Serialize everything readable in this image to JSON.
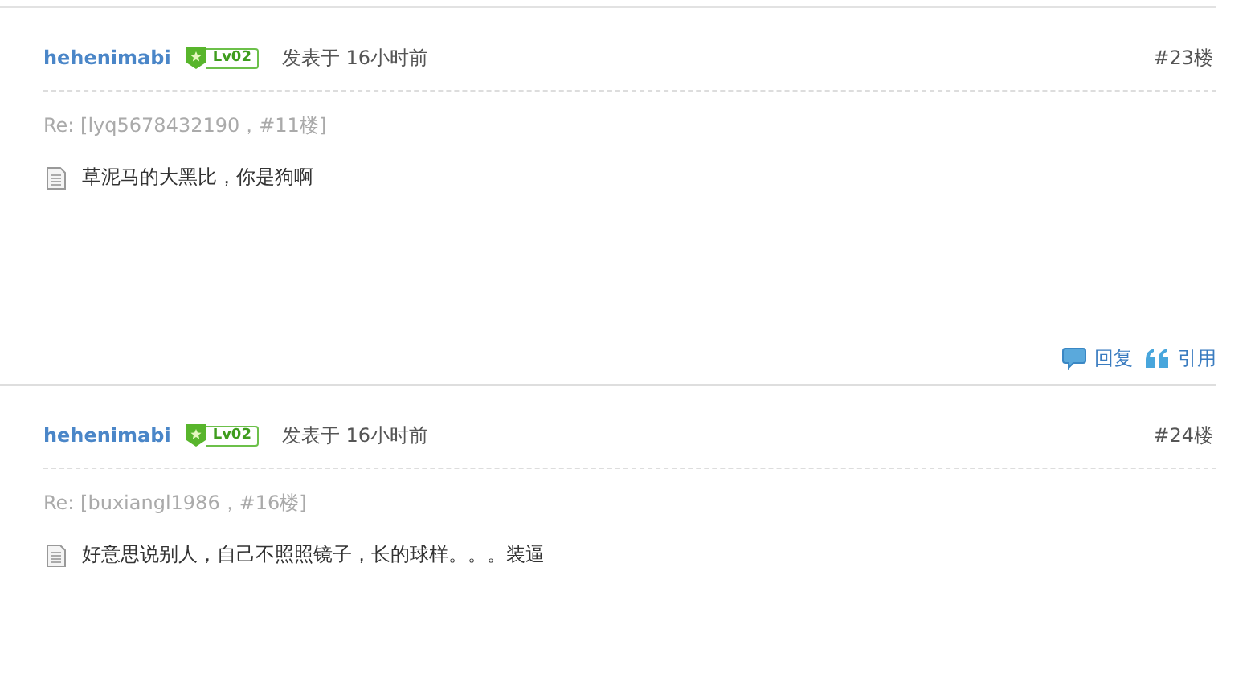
{
  "posts": [
    {
      "author": "hehenimabi",
      "level": "Lv02",
      "time": "发表于 16小时前",
      "floor": "#23楼",
      "reply_to": "Re: [lyq5678432190，#11楼]",
      "content": "草泥马的大黑比，你是狗啊",
      "actions": [
        {
          "kind": "reply",
          "label": "回复"
        },
        {
          "kind": "quote",
          "label": "引用"
        }
      ]
    },
    {
      "author": "hehenimabi",
      "level": "Lv02",
      "time": "发表于 16小时前",
      "floor": "#24楼",
      "reply_to": "Re: [buxiangl1986，#16楼]",
      "content": "好意思说别人，自己不照照镜子，长的球样。。。装逼"
    }
  ]
}
